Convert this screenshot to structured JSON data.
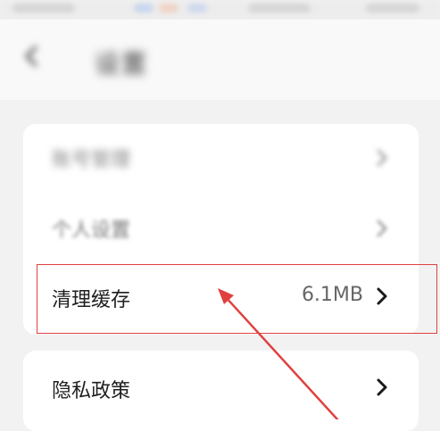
{
  "header": {
    "title": "设置",
    "back_icon": "back-arrow-icon"
  },
  "settings": {
    "top_items": [
      {
        "label": "账号管理",
        "chevron": "chevron-right-icon"
      },
      {
        "label": "个人设置",
        "chevron": "chevron-right-icon"
      },
      {
        "label": "清理缓存",
        "value": "6.1MB",
        "chevron": "chevron-right-icon"
      }
    ],
    "bottom_items": [
      {
        "label": "隐私政策",
        "chevron": "chevron-right-icon"
      }
    ]
  },
  "annotation": {
    "highlight_color": "#e0413f"
  }
}
